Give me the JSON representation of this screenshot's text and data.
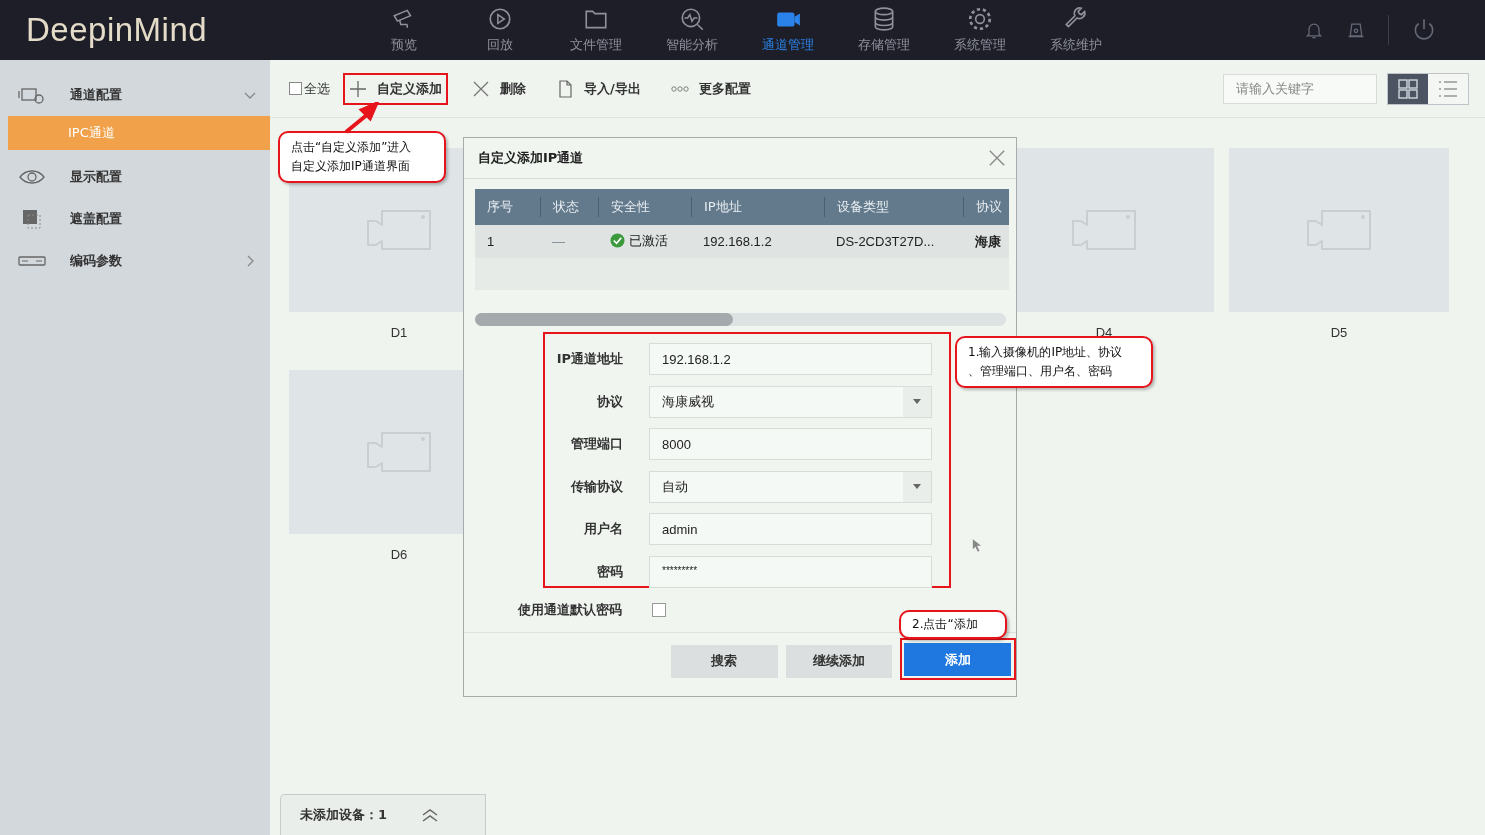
{
  "app": {
    "logo": "DeepinMind"
  },
  "nav": [
    {
      "label": "预览",
      "selected": false
    },
    {
      "label": "回放",
      "selected": false
    },
    {
      "label": "文件管理",
      "selected": false
    },
    {
      "label": "智能分析",
      "selected": false
    },
    {
      "label": "通道管理",
      "selected": true
    },
    {
      "label": "存储管理",
      "selected": false
    },
    {
      "label": "系统管理",
      "selected": false
    },
    {
      "label": "系统维护",
      "selected": false
    }
  ],
  "sidebar": {
    "items": [
      {
        "label": "通道配置",
        "expanded": true,
        "children": [
          {
            "label": "IPC通道",
            "selected": true
          }
        ]
      },
      {
        "label": "显示配置"
      },
      {
        "label": "遮盖配置"
      },
      {
        "label": "编码参数",
        "expanded": false
      }
    ]
  },
  "toolbar": {
    "select_all": {
      "label": "全选",
      "checked": false
    },
    "actions": [
      {
        "label": "自定义添加",
        "highlighted": true
      },
      {
        "label": "删除",
        "highlighted": false
      },
      {
        "label": "导入/导出",
        "highlighted": false
      },
      {
        "label": "更多配置",
        "highlighted": false
      }
    ],
    "search": {
      "placeholder": "请输入关键字"
    },
    "views": [
      {
        "kind": "grid",
        "selected": true
      },
      {
        "kind": "list",
        "selected": false
      }
    ]
  },
  "channels": [
    {
      "label": "D1"
    },
    {
      "label": "D4"
    },
    {
      "label": "D5"
    },
    {
      "label": "D6"
    }
  ],
  "dialog": {
    "title": "自定义添加IP通道",
    "table": {
      "columns": [
        "序号",
        "状态",
        "安全性",
        "IP地址",
        "设备类型",
        "协议"
      ],
      "rows": [
        {
          "index": "1",
          "status": "—",
          "security": "已激活",
          "ip": "192.168.1.2",
          "device_type": "DS-2CD3T27D...",
          "protocol": "海康"
        }
      ]
    },
    "fields": [
      {
        "label": "IP通道地址",
        "kind": "text",
        "value": "192.168.1.2"
      },
      {
        "label": "协议",
        "kind": "select",
        "value": "海康威视"
      },
      {
        "label": "管理端口",
        "kind": "text",
        "value": "8000"
      },
      {
        "label": "传输协议",
        "kind": "select",
        "value": "自动"
      },
      {
        "label": "用户名",
        "kind": "text",
        "value": "admin"
      },
      {
        "label": "密码",
        "kind": "password",
        "value": "*********"
      }
    ],
    "default_password": {
      "label": "使用通道默认密码",
      "checked": false
    },
    "buttons": [
      {
        "label": "搜索",
        "primary": false
      },
      {
        "label": "继续添加",
        "primary": false
      },
      {
        "label": "添加",
        "primary": true
      }
    ]
  },
  "annotations": [
    {
      "lines": [
        "点击“自定义添加”进入",
        "自定义添加IP通道界面"
      ]
    },
    {
      "lines": [
        "1.输入摄像机的IP地址、协议",
        "、管理端口、用户名、密码"
      ]
    },
    {
      "lines": [
        "2.点击“添加"
      ]
    }
  ],
  "bottom_tab": {
    "label": "未添加设备：1"
  }
}
